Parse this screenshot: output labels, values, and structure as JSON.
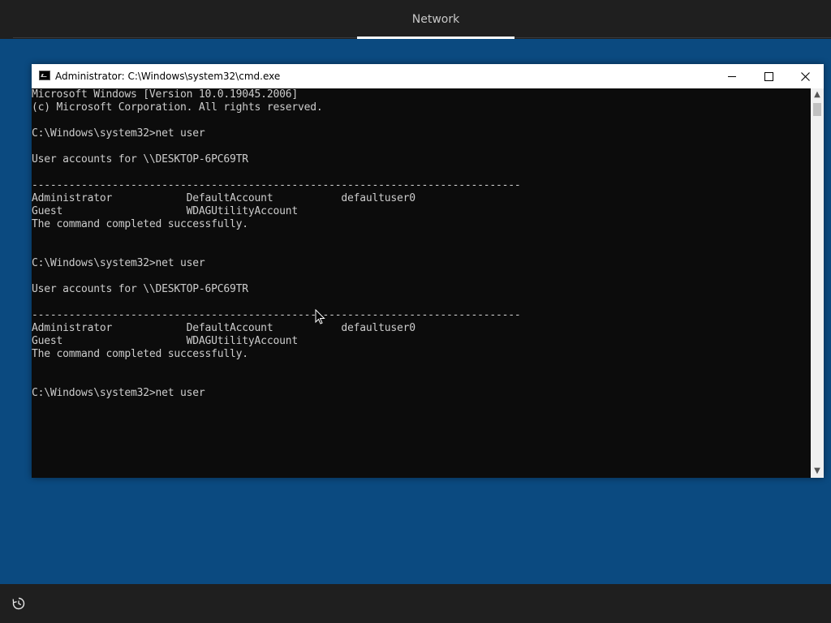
{
  "header": {
    "tab_label": "Network"
  },
  "cmd_window": {
    "title": "Administrator: C:\\Windows\\system32\\cmd.exe",
    "icon": "cmd-icon",
    "controls": [
      "minimize-icon",
      "maximize-icon",
      "close-icon"
    ],
    "background": "#0c0c0c",
    "text_color": "#cccccc"
  },
  "console": {
    "lines": [
      "Microsoft Windows [Version 10.0.19045.2006]",
      "(c) Microsoft Corporation. All rights reserved.",
      "",
      "C:\\Windows\\system32>net user",
      "",
      "User accounts for \\\\DESKTOP-6PC69TR",
      "",
      "-------------------------------------------------------------------------------",
      "Administrator            DefaultAccount           defaultuser0",
      "Guest                    WDAGUtilityAccount",
      "The command completed successfully.",
      "",
      "",
      "C:\\Windows\\system32>net user",
      "",
      "User accounts for \\\\DESKTOP-6PC69TR",
      "",
      "-------------------------------------------------------------------------------",
      "Administrator            DefaultAccount           defaultuser0",
      "Guest                    WDAGUtilityAccount",
      "The command completed successfully.",
      "",
      "",
      "C:\\Windows\\system32>net user"
    ]
  },
  "taskbar": {
    "ease_of_access_icon": "ease-of-access-icon"
  },
  "colors": {
    "desktop": "#0b4a80",
    "header": "#1f1f1f",
    "accent_underline": "#ffffff"
  }
}
